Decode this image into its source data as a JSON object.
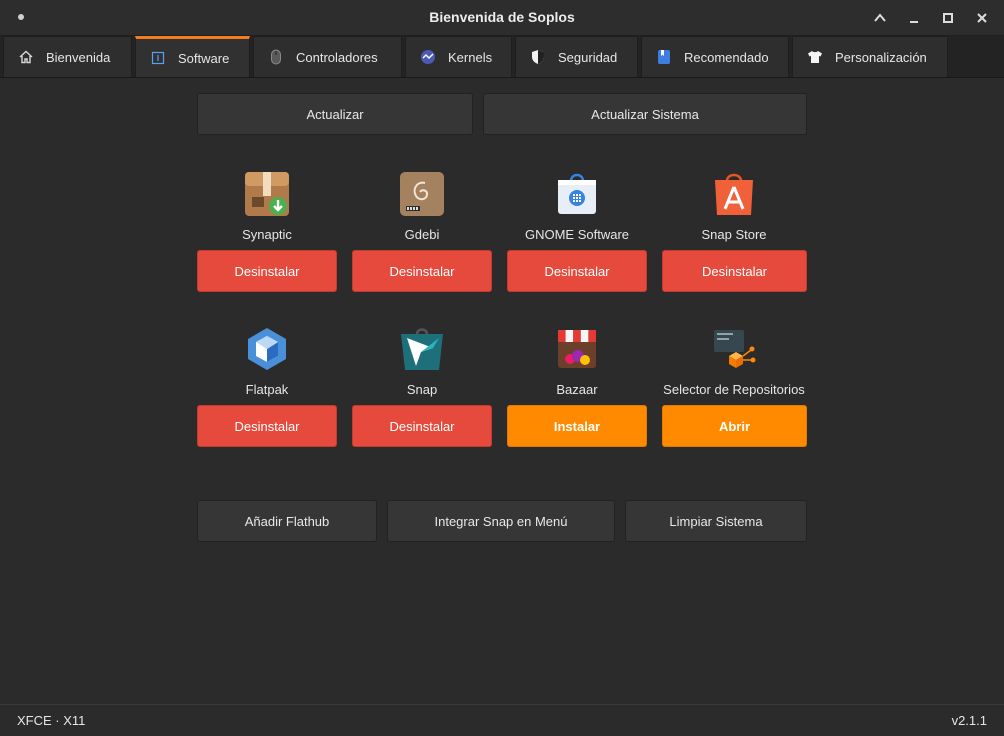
{
  "window": {
    "title": "Bienvenida de Soplos"
  },
  "tabs": [
    {
      "label": "Bienvenida",
      "icon": "home-icon"
    },
    {
      "label": "Software",
      "icon": "software-icon",
      "active": true
    },
    {
      "label": "Controladores",
      "icon": "mouse-icon"
    },
    {
      "label": "Kernels",
      "icon": "kernel-icon"
    },
    {
      "label": "Seguridad",
      "icon": "shield-icon"
    },
    {
      "label": "Recomendado",
      "icon": "bookmark-icon"
    },
    {
      "label": "Personalización",
      "icon": "shirt-icon"
    }
  ],
  "top_actions": {
    "update": "Actualizar",
    "update_system": "Actualizar Sistema"
  },
  "apps": [
    {
      "name": "Synaptic",
      "action": "Desinstalar",
      "icon": "synaptic-icon"
    },
    {
      "name": "Gdebi",
      "action": "Desinstalar",
      "icon": "gdebi-icon"
    },
    {
      "name": "GNOME Software",
      "action": "Desinstalar",
      "icon": "gnome-software-icon"
    },
    {
      "name": "Snap Store",
      "action": "Desinstalar",
      "icon": "snap-store-icon"
    },
    {
      "name": "Flatpak",
      "action": "Desinstalar",
      "icon": "flatpak-icon"
    },
    {
      "name": "Snap",
      "action": "Desinstalar",
      "icon": "snap-icon"
    },
    {
      "name": "Bazaar",
      "action": "Instalar",
      "icon": "bazaar-icon"
    },
    {
      "name": "Selector de Repositorios",
      "action": "Abrir",
      "icon": "repo-selector-icon"
    }
  ],
  "bottom_actions": {
    "add_flathub": "Añadir Flathub",
    "integrate_snap": "Integrar Snap en Menú",
    "clean_system": "Limpiar Sistema"
  },
  "status": {
    "session": "XFCE · X11",
    "version": "v2.1.1"
  },
  "colors": {
    "accent": "#f47c20",
    "uninstall": "#e64a3c",
    "install": "#ff8a00"
  }
}
